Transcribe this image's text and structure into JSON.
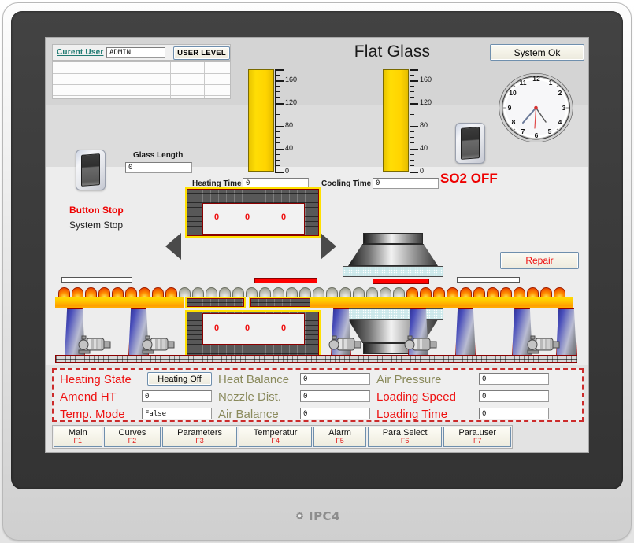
{
  "device": {
    "brand": "IPC4",
    "logo_icon": "gear-icon"
  },
  "header": {
    "title": "Flat Glass",
    "current_user_label": "Curent User",
    "current_user_value": "ADMIN",
    "user_level_button": "USER LEVEL",
    "system_status_button": "System Ok"
  },
  "gauges": [
    {
      "name": "heating-gauge",
      "ticks": [
        "160",
        "120",
        "80",
        "40",
        "0"
      ],
      "min": 0,
      "max": 180,
      "value": 180,
      "color": "#ffd400"
    },
    {
      "name": "cooling-gauge",
      "ticks": [
        "160",
        "120",
        "80",
        "40",
        "0"
      ],
      "min": 0,
      "max": 180,
      "value": 180,
      "color": "#ffd400"
    }
  ],
  "clock": {
    "numerals": [
      "12",
      "1",
      "2",
      "3",
      "4",
      "5",
      "6",
      "7",
      "8",
      "9",
      "10",
      "11"
    ],
    "hour": 6,
    "minute": 37
  },
  "controls": {
    "left_switch": {
      "icon": "toggle-switch-icon",
      "state_label": "Button Stop",
      "sub_label": "System Stop"
    },
    "right_switch": {
      "icon": "toggle-switch-icon",
      "state_label": "SO2 OFF"
    },
    "glass_length": {
      "label": "Glass Length",
      "value": "0"
    },
    "heating_time": {
      "label": "Heating Time",
      "value": "0"
    },
    "cooling_time": {
      "label": "Cooling Time",
      "value": "0"
    },
    "repair_button": "Repair"
  },
  "diagram": {
    "furnace_top_readouts": [
      "0",
      "0",
      "0"
    ],
    "furnace_bottom_readouts": [
      "0",
      "0",
      "0"
    ]
  },
  "parameters": {
    "col1": [
      {
        "label": "Heating State",
        "value": "Heating Off",
        "color": "red",
        "type": "button"
      },
      {
        "label": "Amend  HT",
        "value": "0",
        "color": "red",
        "type": "field"
      },
      {
        "label": "Temp.   Mode",
        "value": "False",
        "color": "red",
        "type": "field"
      }
    ],
    "col2": [
      {
        "label": "Heat Balance",
        "value": "0",
        "color": "olive",
        "type": "field"
      },
      {
        "label": "Nozzle Dist.",
        "value": "0",
        "color": "olive",
        "type": "field"
      },
      {
        "label": "Air Balance",
        "value": "0",
        "color": "olive",
        "type": "field"
      }
    ],
    "col3": [
      {
        "label": "Air Pressure",
        "value": "0",
        "color": "olive",
        "type": "field"
      },
      {
        "label": "Loading Speed",
        "value": "0",
        "color": "red",
        "type": "field"
      },
      {
        "label": "Loading Time",
        "value": "0",
        "color": "red",
        "type": "field"
      }
    ]
  },
  "function_keys": [
    {
      "label": "Main",
      "key": "F1"
    },
    {
      "label": "Curves",
      "key": "F2"
    },
    {
      "label": "Parameters",
      "key": "F3"
    },
    {
      "label": "Temperatur",
      "key": "F4"
    },
    {
      "label": "Alarm",
      "key": "F5"
    },
    {
      "label": "Para.Select",
      "key": "F6"
    },
    {
      "label": "Para.user",
      "key": "F7"
    }
  ],
  "colors": {
    "alarm_red": "#ee1111",
    "label_olive": "#8a8a5c",
    "link_teal": "#1f7a72",
    "gauge_yellow": "#ffd400",
    "screen_bg": "#ededed"
  }
}
